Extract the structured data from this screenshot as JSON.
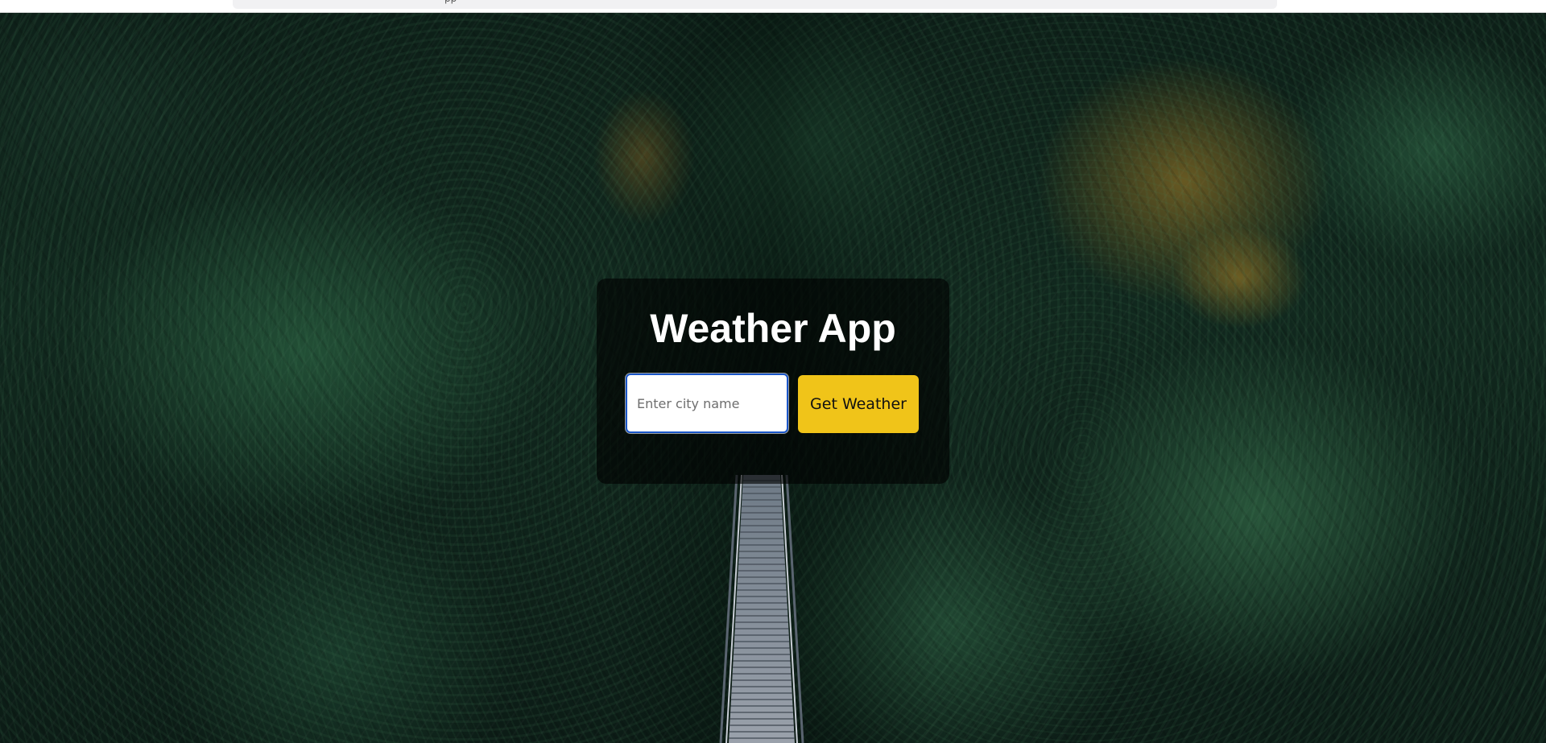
{
  "browser": {
    "tab_fragment": "pp"
  },
  "app": {
    "title": "Weather App"
  },
  "search": {
    "placeholder": "Enter city name",
    "value": "",
    "button_label": "Get Weather"
  },
  "colors": {
    "button_bg": "#f0c419",
    "input_focus_border": "#1a56c9",
    "card_bg": "rgba(0,0,0,0.62)"
  }
}
